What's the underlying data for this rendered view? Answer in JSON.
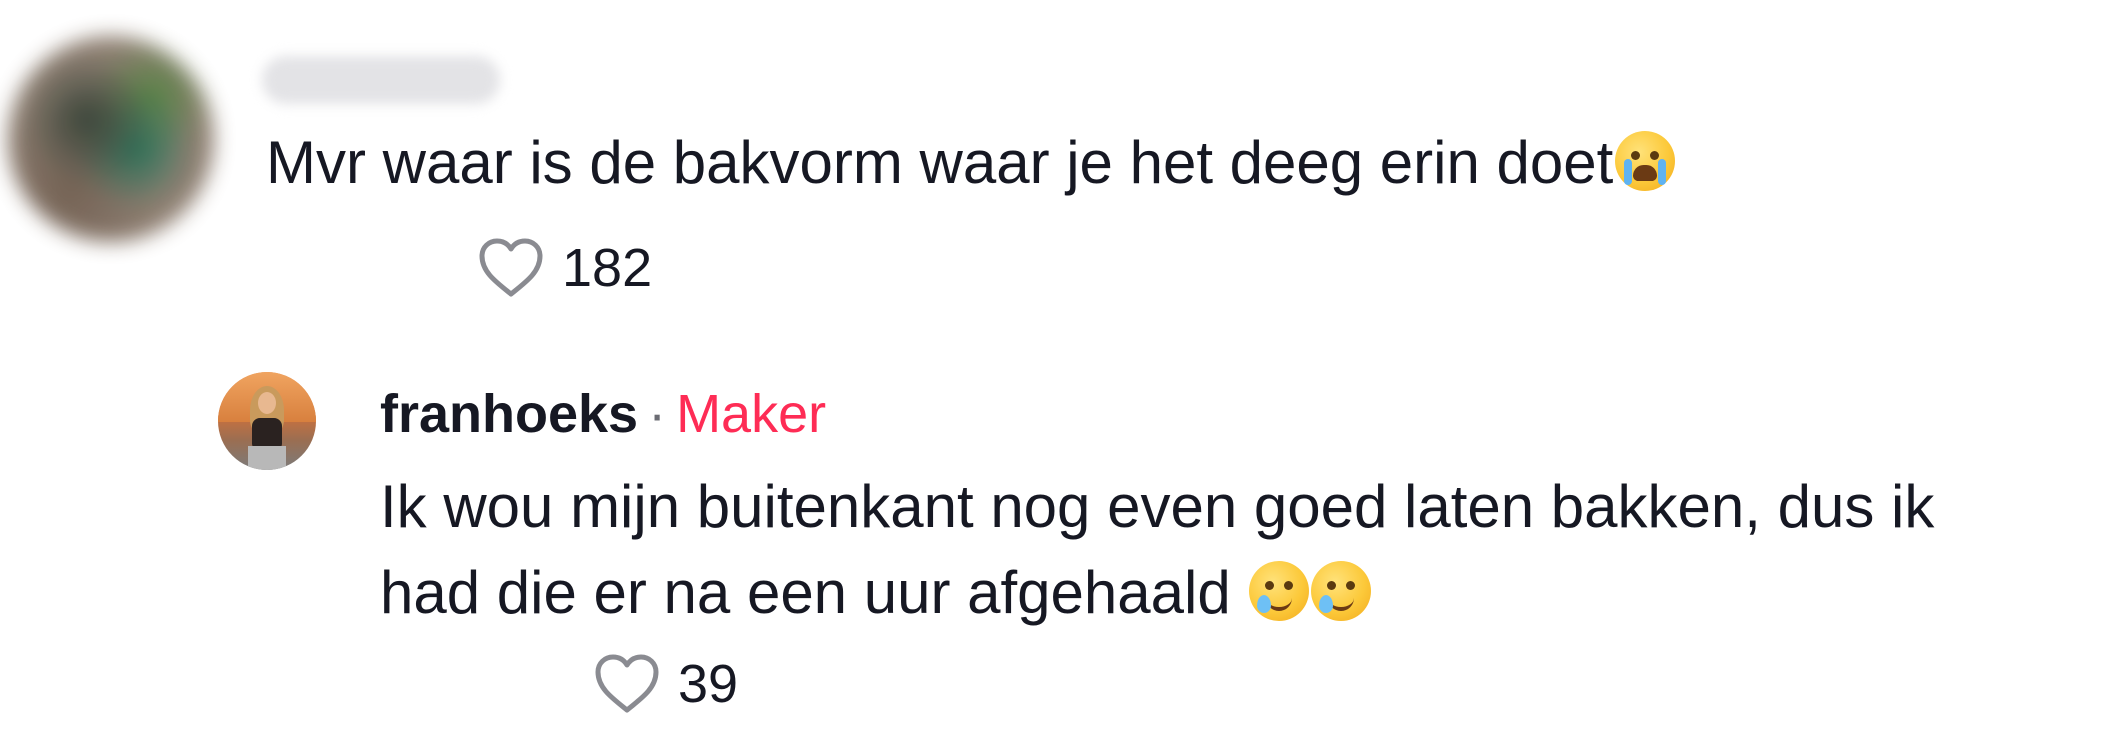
{
  "comment": {
    "username": "",
    "text": "Mvr waar is de bakvorm waar je het deeg erin doet",
    "emoji": "loudly-crying-face",
    "likes": "182"
  },
  "reply": {
    "username": "franhoeks",
    "separator": "·",
    "badge": "Maker",
    "text_line1": "Ik wou mijn buitenkant nog even goed laten bakken, dus ik",
    "text_line2": "had die er na een uur afgehaald",
    "emojis": [
      "face-holding-back-tears",
      "face-holding-back-tears"
    ],
    "likes": "39"
  },
  "colors": {
    "text": "#161823",
    "secondary": "#6b6c73",
    "maker_badge": "#fe2c55",
    "heart_outline": "#8a8b91",
    "background": "#ffffff"
  }
}
